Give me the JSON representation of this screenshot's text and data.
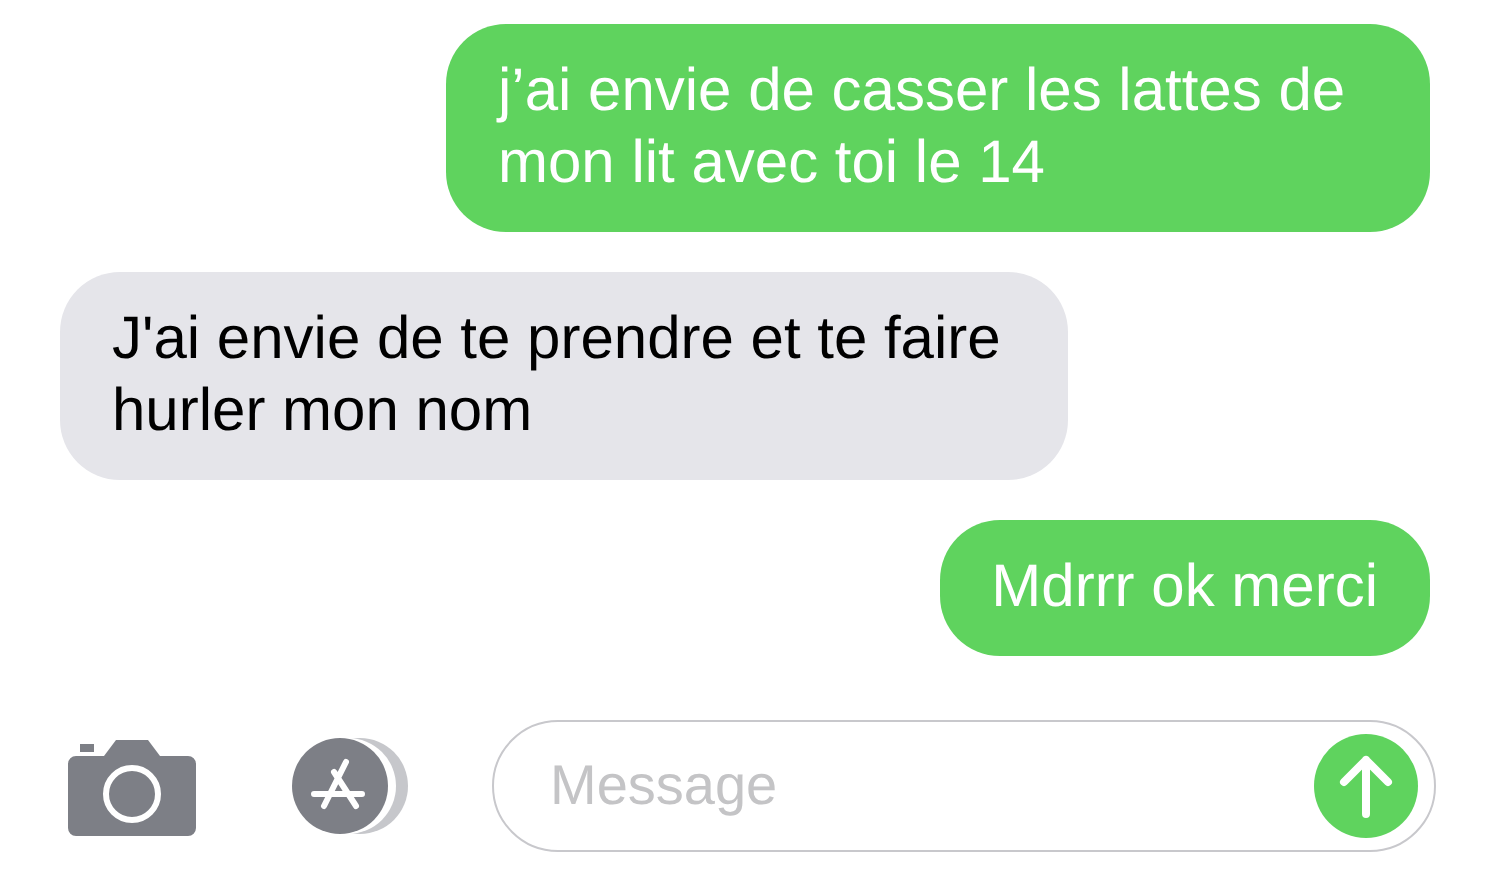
{
  "messages": [
    {
      "kind": "sent",
      "text": "j’ai envie de casser les lattes de mon lit avec toi le 14"
    },
    {
      "kind": "received",
      "text": "J'ai envie de te prendre et te faire hurler mon nom"
    },
    {
      "kind": "sent",
      "text": "Mdrrr ok merci"
    }
  ],
  "composer": {
    "placeholder": "Message"
  }
}
